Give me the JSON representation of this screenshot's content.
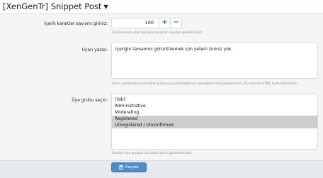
{
  "header": {
    "title": "[XenGenTr] Snippet Post",
    "menu_icon": "caret-down-icon"
  },
  "form": {
    "char_count": {
      "label": "İçerik karakter sayısını giriniz:",
      "value": "100",
      "increment": "+",
      "decrement": "−",
      "hint": "Gösterilecek olan içeriğin karakter sayısını girebilirsiniz."
    },
    "warning_text": {
      "label": "Uyarı yazısı:",
      "value": "İçeriğin tamamını görüntülemek için yeterli izniniz yok.",
      "hint": "Uyarı açıklaması ile birlikte kullanıcıyı yönlendirmek istediğiniz linki girebilirsiniz. Bu alanda HTML kullanabilirsiniz."
    },
    "user_group": {
      "label": "Üye grubu seçin:",
      "options": [
        "(Yok)",
        "Administrative",
        "Moderating",
        "Registered",
        "Unregistered / Unconfirmed"
      ],
      "selected": [
        "Registered",
        "Unregistered / Unconfirmed"
      ],
      "hint": "Seçilen üye gruplarına özelli içerik gösterilecektir."
    }
  },
  "footer": {
    "save_label": "Kaydet",
    "save_icon": "save-icon"
  },
  "colors": {
    "accent": "#2577b1",
    "button": "#4f8bc4",
    "selected_row": "#cecece"
  }
}
